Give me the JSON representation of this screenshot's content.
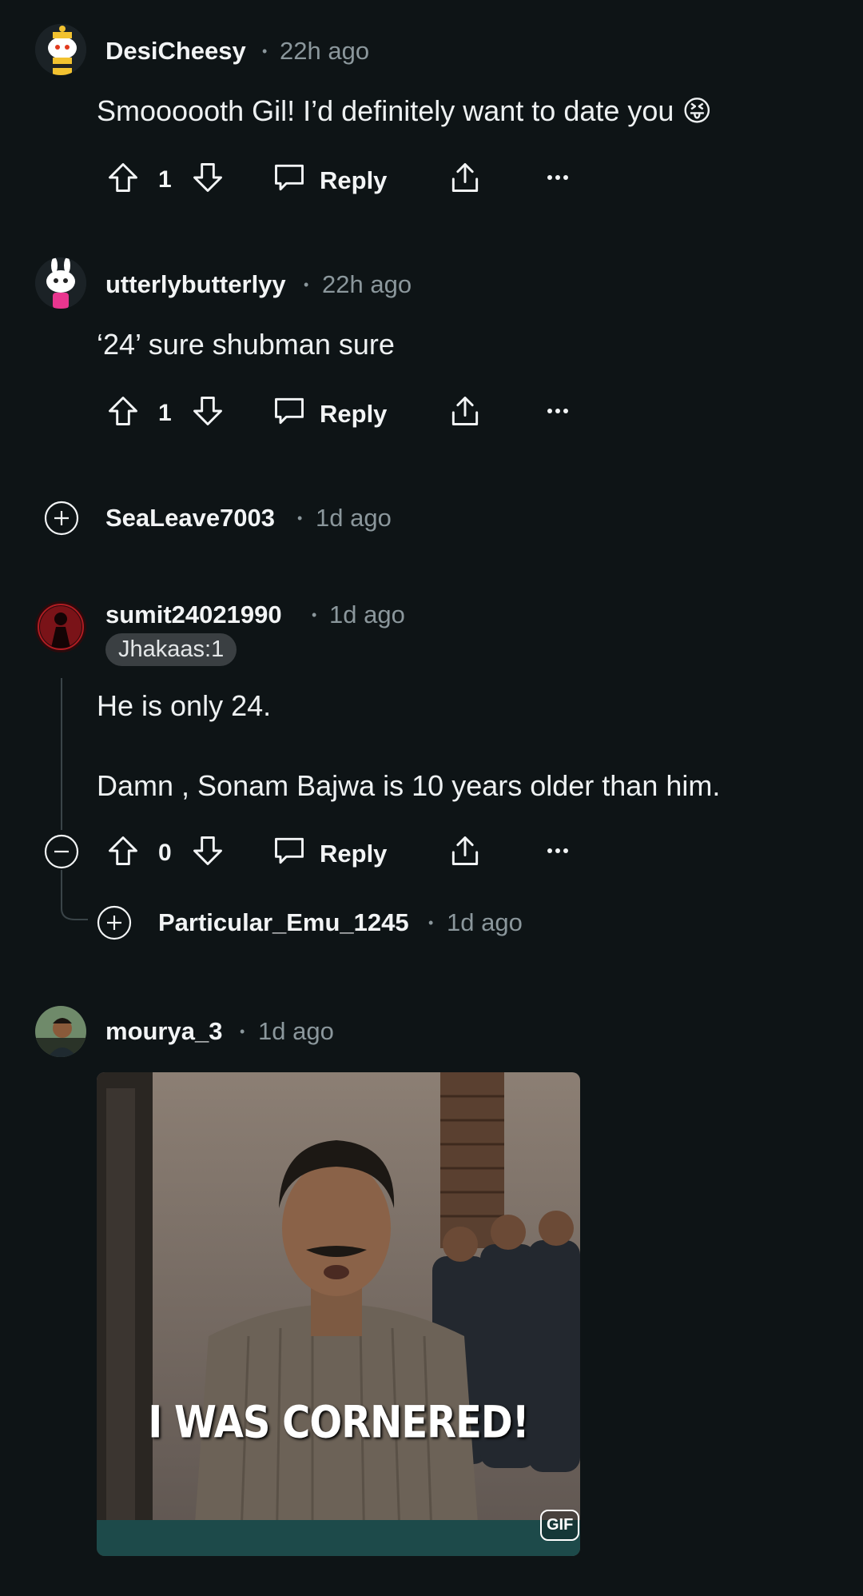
{
  "comments": [
    {
      "username": "DesiCheesy",
      "age": "22h ago",
      "text": "Smoooooth Gil! I’d definitely want to date you",
      "emoji": "😝",
      "votes": "1",
      "reply_label": "Reply"
    },
    {
      "username": "utterlybutterlyy",
      "age": "22h ago",
      "text": "‘24’ sure shubman sure",
      "votes": "1",
      "reply_label": "Reply"
    },
    {
      "username": "SeaLeave7003",
      "age": "1d ago",
      "collapsed": true
    },
    {
      "username": "sumit24021990",
      "age": "1d ago",
      "flair": "Jhakaas:1",
      "text_line1": "He is only 24.",
      "text_line2": "Damn , Sonam Bajwa is 10 years older than him.",
      "votes": "0",
      "reply_label": "Reply"
    },
    {
      "username": "Particular_Emu_1245",
      "age": "1d ago",
      "collapsed": true
    },
    {
      "username": "mourya_3",
      "age": "1d ago",
      "gif_caption": "I WAS CORNERED!",
      "gif_badge": "GIF"
    }
  ],
  "separator": "•",
  "colors": {
    "background": "#0e1416",
    "muted": "#8b979c",
    "flair_bg": "#3a3f42"
  }
}
